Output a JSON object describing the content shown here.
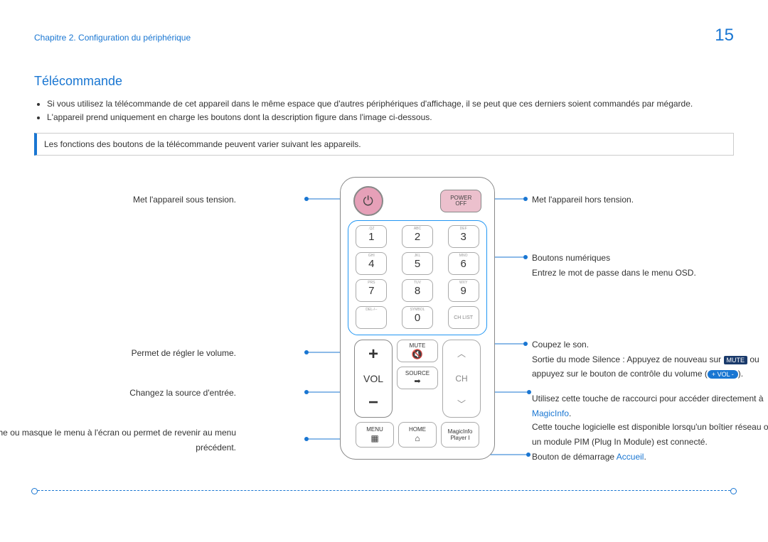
{
  "header": {
    "chapter": "Chapitre 2. Configuration du périphérique",
    "page": "15"
  },
  "title": "Télécommande",
  "bullets": [
    "Si vous utilisez la télécommande de cet appareil dans le même espace que d'autres périphériques d'affichage, il se peut que ces derniers soient commandés par mégarde.",
    "L'appareil prend uniquement en charge les boutons dont la description figure dans l'image ci-dessous."
  ],
  "note": "Les fonctions des boutons de la télécommande peuvent varier suivant les appareils.",
  "remote": {
    "power_off_top": "POWER",
    "power_off_bottom": "OFF",
    "keys": [
      {
        "sub": ".QZ",
        "num": "1"
      },
      {
        "sub": "ABC",
        "num": "2"
      },
      {
        "sub": "DEF",
        "num": "3"
      },
      {
        "sub": "GHI",
        "num": "4"
      },
      {
        "sub": "JKL",
        "num": "5"
      },
      {
        "sub": "MNO",
        "num": "6"
      },
      {
        "sub": "PRS",
        "num": "7"
      },
      {
        "sub": "TUV",
        "num": "8"
      },
      {
        "sub": "WXY",
        "num": "9"
      },
      {
        "sub": "DEL-/--",
        "num": ""
      },
      {
        "sub": "SYMBOL",
        "num": "0"
      },
      {
        "sub": "",
        "num": "CH LIST"
      }
    ],
    "vol_label": "VOL",
    "plus": "+",
    "minus": "−",
    "mute": "MUTE",
    "source": "SOURCE",
    "ch": "CH",
    "menu": "MENU",
    "home": "HOME",
    "magic_top": "MagicInfo",
    "magic_bot": "Player I"
  },
  "labels": {
    "L1": "Met l'appareil sous tension.",
    "L2": "Permet de régler le volume.",
    "L3": "Changez la source d'entrée.",
    "L4": "Affiche ou masque le menu à l'écran ou permet de revenir au menu précédent.",
    "R1": "Met l'appareil hors tension.",
    "R2a": "Boutons numériques",
    "R2b": "Entrez le mot de passe dans le menu OSD.",
    "R3a": "Coupez le son.",
    "R3b_pre": "Sortie du mode Silence : Appuyez de nouveau sur ",
    "R3b_mute": "MUTE",
    "R3b_mid": " ou appuyez sur le bouton de contrôle du volume (",
    "R3b_vol": "+ VOL -",
    "R3b_end": ").",
    "R4a": "Utilisez cette touche de raccourci pour accéder directement à ",
    "R4b": "MagicInfo",
    "R4c": ".",
    "R5a": "Cette touche logicielle est disponible lorsqu'un boîtier réseau ou un module PIM (Plug In Module) est connecté.",
    "R6a": "Bouton de démarrage ",
    "R6b": "Accueil",
    "R6c": "."
  }
}
